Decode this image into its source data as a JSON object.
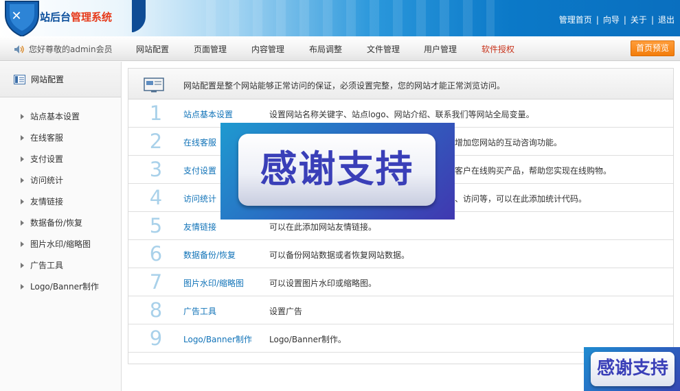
{
  "header": {
    "brand_prefix": "站后台",
    "brand_highlight": "管理系统",
    "links": [
      "管理首页",
      "向导",
      "关于",
      "退出"
    ],
    "close_icon": "close-icon",
    "colors": {
      "brand": "#0a4e9b",
      "highlight": "#e63a1a",
      "banner_blue": "#0b79c8"
    }
  },
  "nav": {
    "welcome": "您好尊敬的admin会员",
    "items": [
      "网站配置",
      "页面管理",
      "内容管理",
      "布局调整",
      "文件管理",
      "用户管理",
      "软件授权"
    ],
    "active_item": "软件授权",
    "preview_label": "首页预览",
    "colors": {
      "active": "#c8321a",
      "preview_btn": "#f37d0b"
    }
  },
  "sidebar": {
    "title": "网站配置",
    "items": [
      "站点基本设置",
      "在线客服",
      "支付设置",
      "访问统计",
      "友情链接",
      "数据备份/恢复",
      "图片水印/缩略图",
      "广告工具",
      "Logo/Banner制作"
    ]
  },
  "main": {
    "intro": "网站配置是整个网站能够正常访问的保证，必须设置完整，您的网站才能正常浏览访问。",
    "rows": [
      {
        "num": "1",
        "title": "站点基本设置",
        "desc": "设置网站名称关键字、站点logo、网站介绍、联系我们等网站全局变量。"
      },
      {
        "num": "2",
        "title": "在线客服",
        "desc": "增加您网站的互动咨询功能。"
      },
      {
        "num": "3",
        "title": "支付设置",
        "desc": "客户在线购买产品，帮助您实现在线购物。"
      },
      {
        "num": "4",
        "title": "访问统计",
        "desc": "、访问等，可以在此添加统计代码。"
      },
      {
        "num": "5",
        "title": "友情链接",
        "desc": "可以在此添加网站友情链接。"
      },
      {
        "num": "6",
        "title": "数据备份/恢复",
        "desc": "可以备份网站数据或者恢复网站数据。"
      },
      {
        "num": "7",
        "title": "图片水印/缩略图",
        "desc": "可以设置图片水印或缩略图。"
      },
      {
        "num": "8",
        "title": "广告工具",
        "desc": "设置广告"
      },
      {
        "num": "9",
        "title": "Logo/Banner制作",
        "desc": "Logo/Banner制作。"
      }
    ],
    "colors": {
      "link": "#1173b8",
      "number": "#a9d1ea"
    }
  },
  "overlays": {
    "thanks_big": "感谢支持",
    "thanks_small": "感谢支持"
  }
}
